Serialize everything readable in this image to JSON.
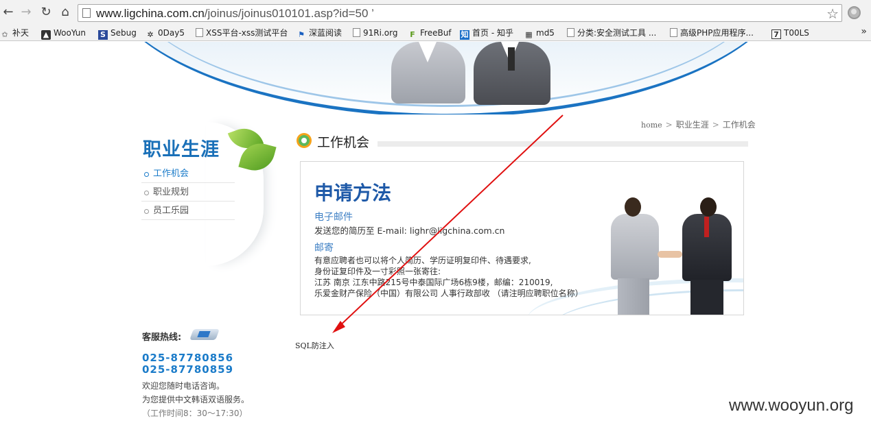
{
  "browser": {
    "url_host": "www.ligchina.com.cn",
    "url_path": "/joinus/joinus010101.asp?id=50 ’",
    "bookmarks": [
      {
        "label": "补天",
        "icon": "star-icon"
      },
      {
        "label": "WooYun",
        "icon": "wooyun-icon"
      },
      {
        "label": "Sebug",
        "icon": "sebug-icon"
      },
      {
        "label": "0Day5",
        "icon": "burst-icon"
      },
      {
        "label": "XSS平台-xss测试平台",
        "icon": "page-icon"
      },
      {
        "label": "深蓝阅读",
        "icon": "bookmark-flag-icon"
      },
      {
        "label": "91Ri.org",
        "icon": "page-icon"
      },
      {
        "label": "FreeBuf",
        "icon": "freebuf-icon"
      },
      {
        "label": "首页 - 知乎",
        "icon": "zhihu-icon"
      },
      {
        "label": "md5",
        "icon": "md5-icon"
      },
      {
        "label": "分类:安全测试工具 ...",
        "icon": "page-icon"
      },
      {
        "label": "高级PHP应用程序...",
        "icon": "page-icon"
      },
      {
        "label": "T00LS",
        "icon": "tools-icon"
      }
    ],
    "more": "»"
  },
  "sidebar": {
    "title": "职业生涯",
    "items": [
      {
        "label": "工作机会",
        "active": true
      },
      {
        "label": "职业规划",
        "active": false
      },
      {
        "label": "员工乐园",
        "active": false
      }
    ]
  },
  "hotline": {
    "label": "客服热线:",
    "phone1": "025-87780856",
    "phone2": "025-87780859",
    "line1": "欢迎您随时电话咨询。",
    "line2": "为您提供中文韩语双语服务。",
    "hours": "（工作时间8：30～17:30）"
  },
  "breadcrumb": {
    "home": "home",
    "level1": "职业生涯",
    "level2": "工作机会",
    "sep": ">"
  },
  "section": {
    "heading": "工作机会"
  },
  "panel": {
    "title": "申请方法",
    "email_head": "电子邮件",
    "email_line": "发送您的简历至 E-mail: lighr@ligchina.com.cn",
    "mail_head": "邮寄",
    "mail_line1": "有意应聘者也可以将个人简历、学历证明复印件、待遇要求,",
    "mail_line2": "身份证复印件及一寸彩照一张寄往:",
    "mail_line3": "江苏 南京 江东中路215号中泰国际广场6栋9楼，邮编：210019,",
    "mail_line4": "乐爱金财产保险（中国）有限公司 人事行政部收 （请注明应聘职位名称）"
  },
  "note": "SQL防注入",
  "watermark": "www.wooyun.org",
  "colors": {
    "brand_blue": "#1a70b8",
    "arrow_red": "#e01010"
  }
}
